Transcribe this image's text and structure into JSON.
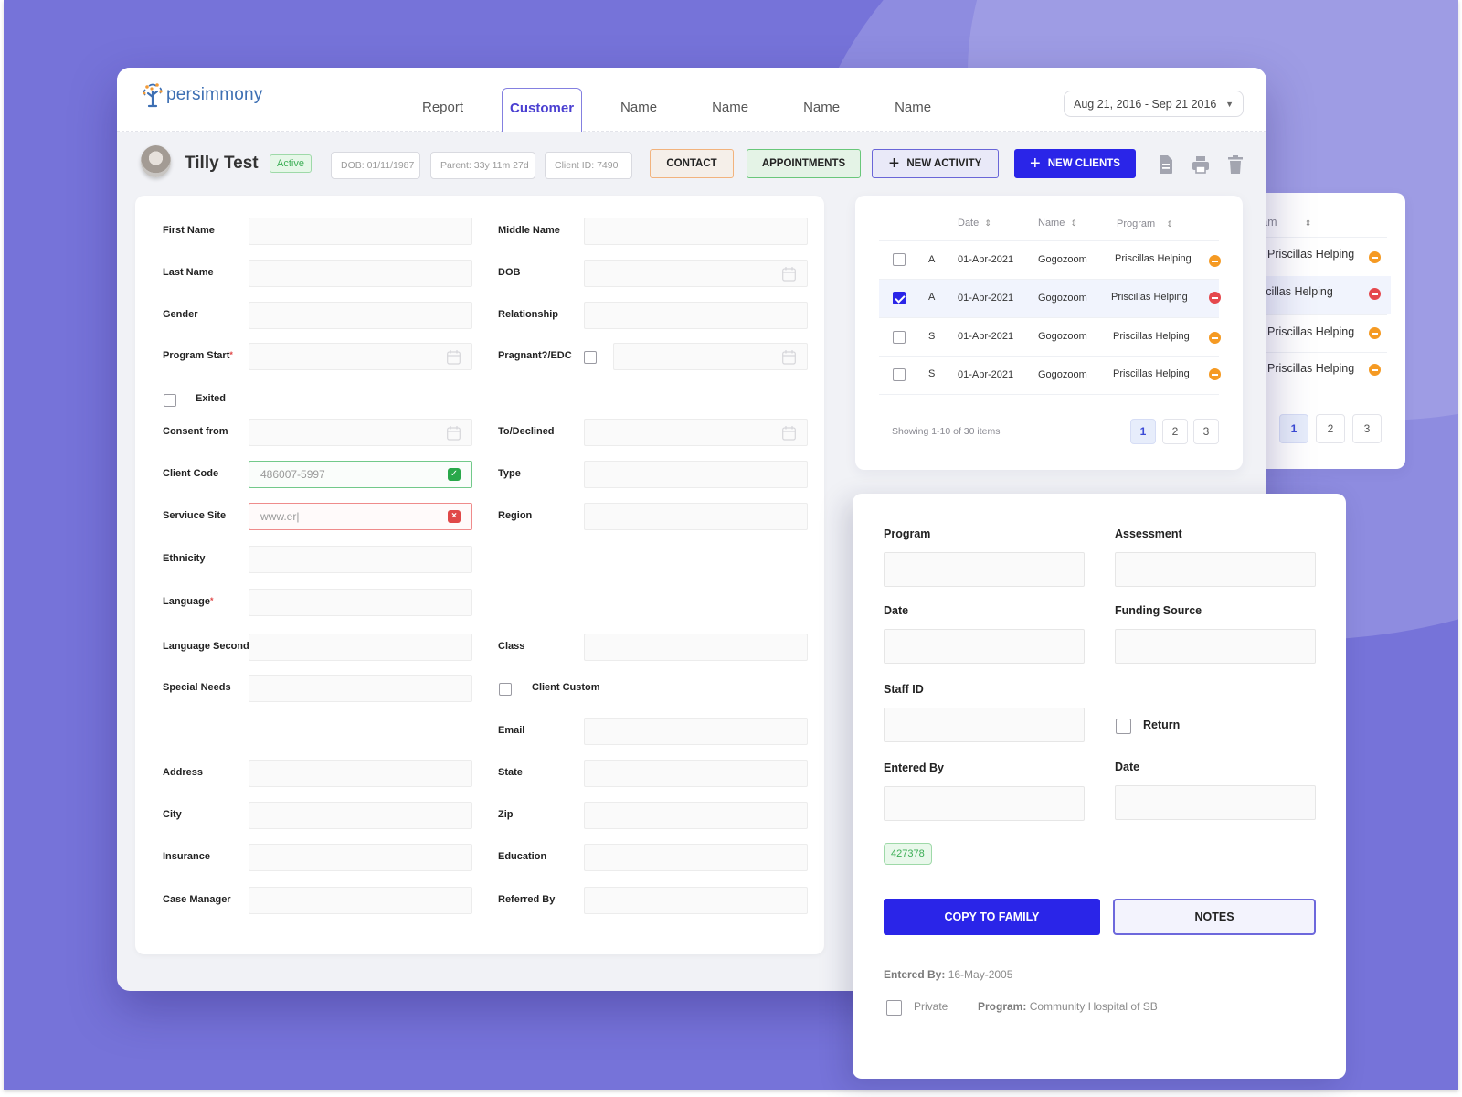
{
  "app": {
    "logo_text": "persimmony",
    "tabs": [
      {
        "label": "Report",
        "active": false
      },
      {
        "label": "Customer",
        "active": true
      },
      {
        "label": "Name",
        "active": false
      },
      {
        "label": "Name",
        "active": false
      },
      {
        "label": "Name",
        "active": false
      },
      {
        "label": "Name",
        "active": false
      }
    ],
    "date_range": "Aug 21, 2016 - Sep 21 2016"
  },
  "client": {
    "name": "Tilly Test",
    "status": "Active",
    "dob": "DOB: 01/11/1987",
    "parent": "Parent: 33y 11m 27d",
    "client_id": "Client ID: 7490"
  },
  "actions": {
    "contact": "CONTACT",
    "appointments": "APPOINTMENTS",
    "new_activity": "NEW ACTIVITY",
    "new_clients": "NEW CLIENTS",
    "icons": [
      "document-icon",
      "print-icon",
      "trash-icon"
    ]
  },
  "colors": {
    "accent": "#2a25e8",
    "background": "#7673d9",
    "success": "#29a84a",
    "error": "#e04848",
    "warning": "#f59a23"
  },
  "form": {
    "left": [
      {
        "label": "First Name",
        "value": ""
      },
      {
        "label": "Last  Name",
        "value": ""
      },
      {
        "label": "Gender",
        "value": ""
      },
      {
        "label": "Program Start",
        "required": true,
        "value": "",
        "calendar": true
      },
      {
        "label": "Consent from",
        "value": "",
        "calendar": true
      },
      {
        "label": "Client Code",
        "value": "486007-5997",
        "state": "valid"
      },
      {
        "label": "Serviuce Site",
        "value": "www.er|",
        "state": "invalid"
      },
      {
        "label": "Ethnicity",
        "value": ""
      },
      {
        "label": "Language",
        "required": true,
        "value": ""
      },
      {
        "label": "Language Second",
        "value": ""
      },
      {
        "label": "Special Needs",
        "value": ""
      },
      {
        "label": "Address",
        "value": ""
      },
      {
        "label": "City",
        "value": ""
      },
      {
        "label": "Insurance",
        "value": ""
      },
      {
        "label": "Case Manager",
        "value": ""
      }
    ],
    "right": [
      {
        "label": "Middle Name",
        "value": ""
      },
      {
        "label": "DOB",
        "value": "",
        "calendar": true
      },
      {
        "label": "Relationship",
        "value": ""
      },
      {
        "label": "Pragnant?/EDC",
        "value": "",
        "calendar": true,
        "checkbox": false
      },
      {
        "label": "To/Declined",
        "value": "",
        "calendar": true
      },
      {
        "label": "Type",
        "value": ""
      },
      {
        "label": "Region",
        "value": ""
      },
      {
        "label": "Class",
        "value": ""
      },
      {
        "label": "Email",
        "value": ""
      },
      {
        "label": "State",
        "value": ""
      },
      {
        "label": "Zip",
        "value": ""
      },
      {
        "label": "Education",
        "value": ""
      },
      {
        "label": "Referred By",
        "value": ""
      }
    ],
    "exited_label": "Exited",
    "exited_checked": false,
    "client_custom_label": "Client Custom",
    "client_custom_checked": false
  },
  "table": {
    "columns": [
      "Date",
      "Name",
      "Program"
    ],
    "rows": [
      {
        "type": "A",
        "date": "01-Apr-2021",
        "name": "Gogozoom",
        "program": "Priscillas Helping",
        "status": "orange",
        "checked": false
      },
      {
        "type": "A",
        "date": "01-Apr-2021",
        "name": "Gogozoom",
        "program": "Priscillas Helping",
        "status": "red",
        "checked": true
      },
      {
        "type": "S",
        "date": "01-Apr-2021",
        "name": "Gogozoom",
        "program": "Priscillas Helping",
        "status": "orange",
        "checked": false
      },
      {
        "type": "S",
        "date": "01-Apr-2021",
        "name": "Gogozoom",
        "program": "Priscillas Helping",
        "status": "orange",
        "checked": false
      }
    ],
    "showing": "Showing 1-10 of 30 items",
    "pages": [
      "1",
      "2",
      "3"
    ],
    "current_page": "1"
  },
  "table_back": {
    "column": "rogram",
    "rows": [
      "Priscillas Helping",
      "riscillas Helping",
      "Priscillas Helping",
      "Priscillas Helping"
    ],
    "statuses": [
      "orange",
      "red",
      "orange",
      "orange"
    ],
    "pages": [
      "1",
      "2",
      "3"
    ]
  },
  "activity": {
    "program_label": "Program",
    "assessment_label": "Assessment",
    "date_label": "Date",
    "funding_label": "Funding Source",
    "staff_label": "Staff ID",
    "return_label": "Return",
    "entered_by_label": "Entered By",
    "date2_label": "Date",
    "tag": "427378",
    "copy_button": "COPY TO FAMILY",
    "notes_button": "NOTES",
    "entered_by_meta_label": "Entered By:",
    "entered_by_meta_value": "16-May-2005",
    "private_label": "Private",
    "program_meta_label": "Program:",
    "program_meta_value": "Community Hospital of SB"
  }
}
